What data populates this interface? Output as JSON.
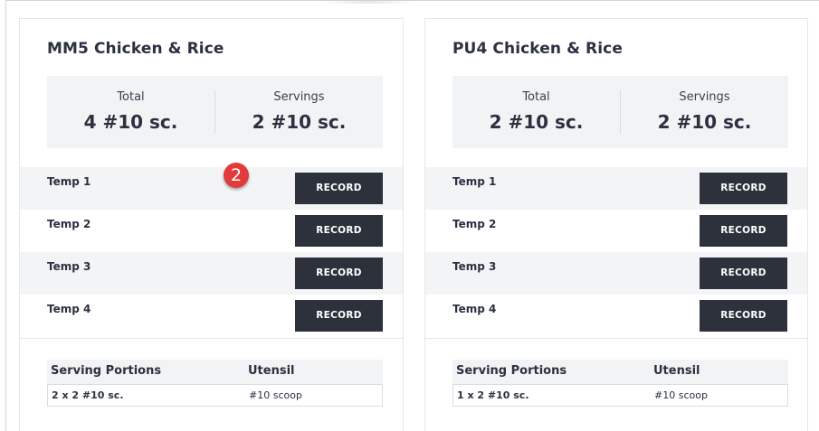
{
  "cards": [
    {
      "title": "MM5 Chicken & Rice",
      "summary": {
        "total_label": "Total",
        "total_value": "4 #10 sc.",
        "servings_label": "Servings",
        "servings_value": "2 #10 sc."
      },
      "temps": [
        {
          "label": "Temp 1",
          "button": "RECORD"
        },
        {
          "label": "Temp 2",
          "button": "RECORD"
        },
        {
          "label": "Temp 3",
          "button": "RECORD"
        },
        {
          "label": "Temp 4",
          "button": "RECORD"
        }
      ],
      "portions": {
        "headers": [
          "Serving Portions",
          "Utensil"
        ],
        "rows": [
          [
            "2 x 2 #10 sc.",
            "#10 scoop"
          ]
        ]
      }
    },
    {
      "title": "PU4 Chicken & Rice",
      "summary": {
        "total_label": "Total",
        "total_value": "2 #10 sc.",
        "servings_label": "Servings",
        "servings_value": "2 #10 sc."
      },
      "temps": [
        {
          "label": "Temp 1",
          "button": "RECORD"
        },
        {
          "label": "Temp 2",
          "button": "RECORD"
        },
        {
          "label": "Temp 3",
          "button": "RECORD"
        },
        {
          "label": "Temp 4",
          "button": "RECORD"
        }
      ],
      "portions": {
        "headers": [
          "Serving Portions",
          "Utensil"
        ],
        "rows": [
          [
            "1 x 2 #10 sc.",
            "#10 scoop"
          ]
        ]
      }
    }
  ],
  "annotation": {
    "step_number": "2",
    "color": "#e23b3b"
  },
  "colors": {
    "button_bg": "#2c313b",
    "button_text": "#ffffff",
    "panel_bg": "#f2f3f5"
  }
}
